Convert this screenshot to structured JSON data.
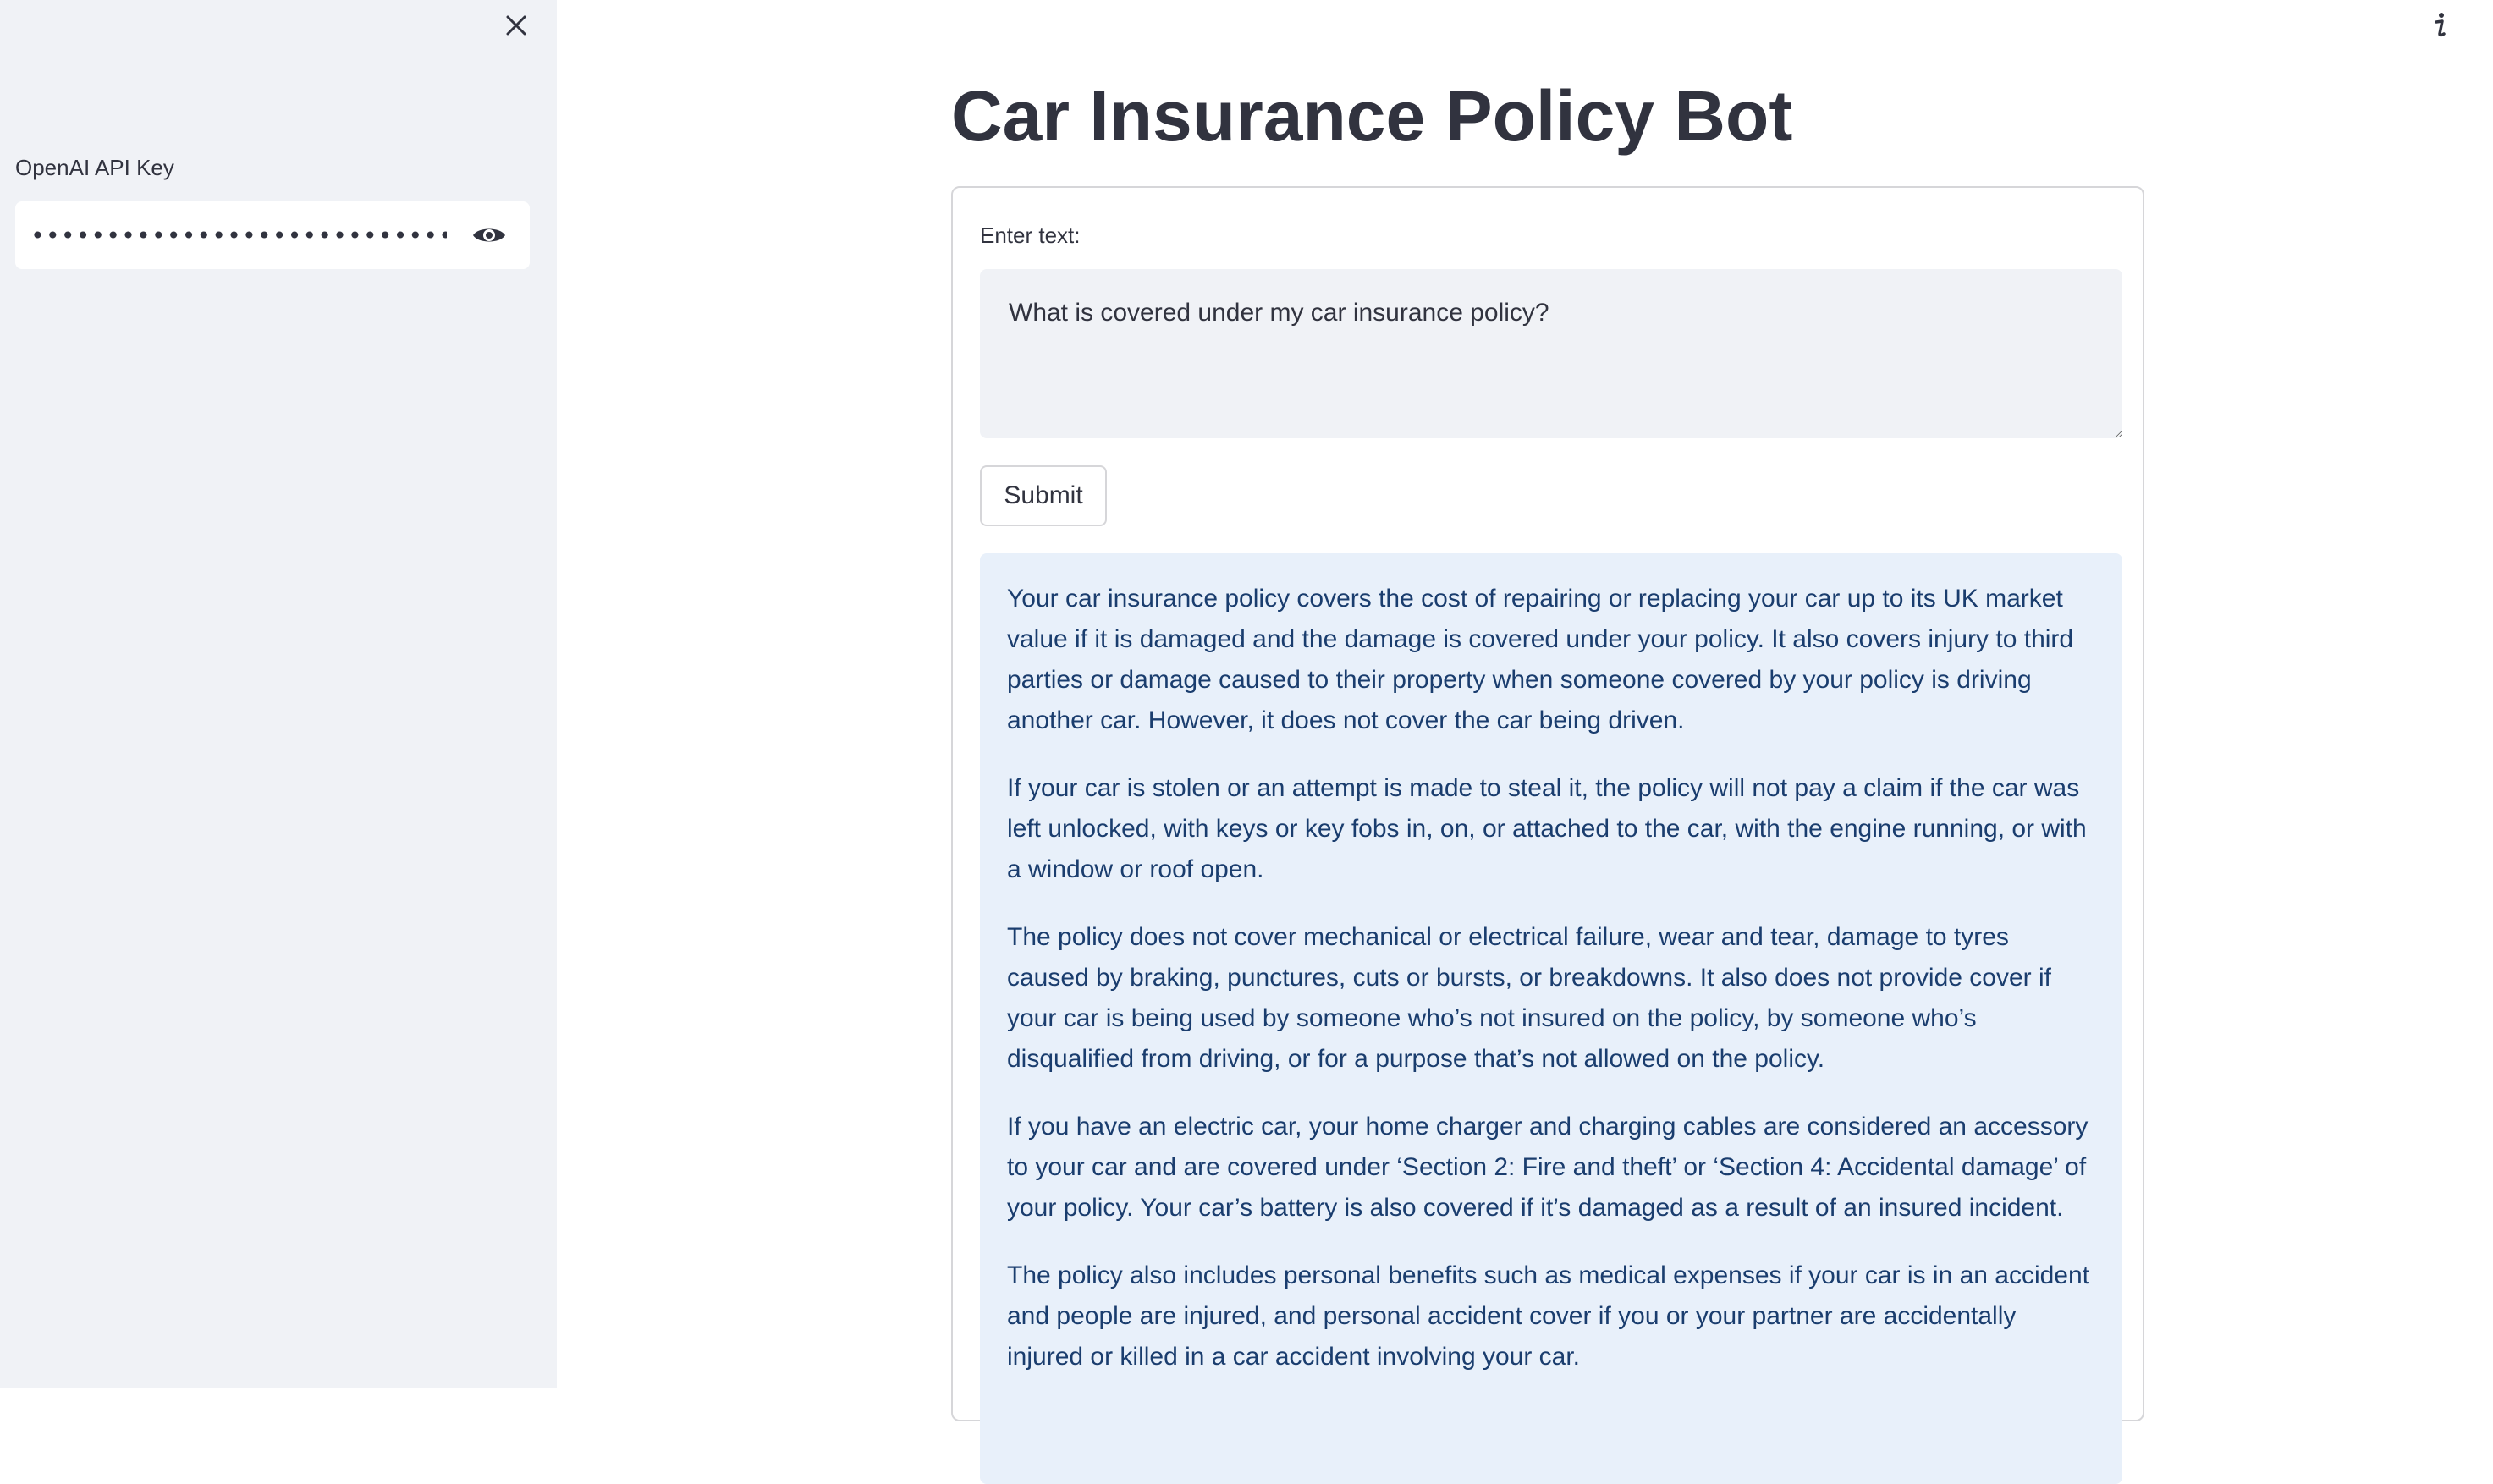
{
  "sidebar": {
    "api_key_label": "OpenAI API Key",
    "api_key_value": "••••••••••••••••••••••••••••••••••••••••••••••••••••"
  },
  "main": {
    "title": "Car Insurance Policy Bot",
    "input_label": "Enter text:",
    "input_value": "What is covered under my car insurance policy?",
    "submit_label": "Submit",
    "answer_paragraphs": [
      "Your car insurance policy covers the cost of repairing or replacing your car up to its UK market value if it is damaged and the damage is covered under your policy. It also covers injury to third parties or damage caused to their property when someone covered by your policy is driving another car. However, it does not cover the car being driven.",
      "If your car is stolen or an attempt is made to steal it, the policy will not pay a claim if the car was left unlocked, with keys or key fobs in, on, or attached to the car, with the engine running, or with a window or roof open.",
      "The policy does not cover mechanical or electrical failure, wear and tear, damage to tyres caused by braking, punctures, cuts or bursts, or breakdowns. It also does not provide cover if your car is being used by someone who’s not insured on the policy, by someone who’s disqualified from driving, or for a purpose that’s not allowed on the policy.",
      "If you have an electric car, your home charger and charging cables are considered an accessory to your car and are covered under ‘Section 2: Fire and theft’ or ‘Section 4: Accidental damage’ of your policy. Your car’s battery is also covered if it’s damaged as a result of an insured incident.",
      "The policy also includes personal benefits such as medical expenses if your car is in an accident and people are injured, and personal accident cover if you or your partner are accidentally injured or killed in a car accident involving your car."
    ]
  },
  "icons": {
    "close": "close-icon",
    "eye": "eye-icon",
    "info": "info-icon"
  }
}
